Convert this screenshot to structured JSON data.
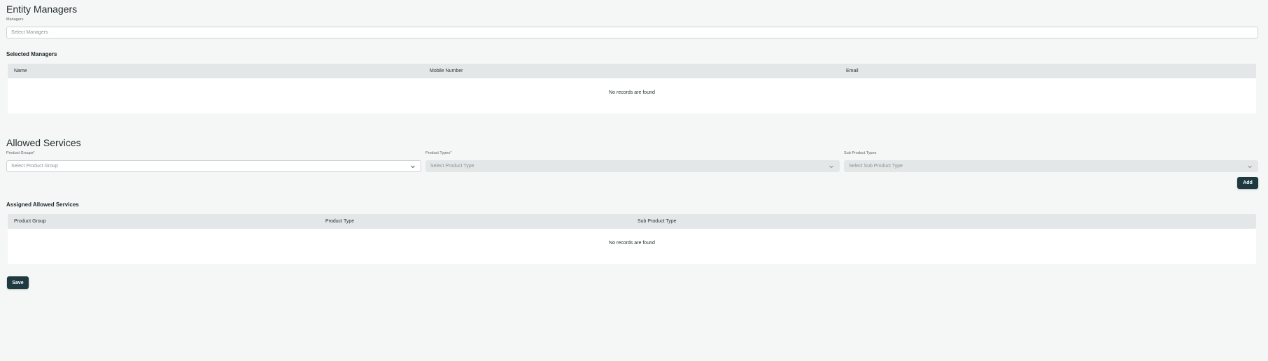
{
  "entity_managers": {
    "title": "Entity Managers",
    "managers_label": "Managers",
    "managers_placeholder": "Select Managers"
  },
  "selected_managers": {
    "title": "Selected Managers",
    "columns": [
      "Name",
      "Mobile Number",
      "Email"
    ],
    "empty_text": "No records are found"
  },
  "allowed_services": {
    "title": "Allowed Services",
    "product_groups_label": "Product Groups",
    "product_groups_placeholder": "Select Product Group",
    "product_types_label": "Product Types",
    "product_types_placeholder": "Select Product Type",
    "sub_product_types_label": "Sub Product Types",
    "sub_product_types_placeholder": "Select Sub Product Type",
    "required_marker": "*",
    "add_label": "Add"
  },
  "assigned_services": {
    "title": "Assigned Allowed Services",
    "columns": [
      "Product Group",
      "Product Type",
      "Sub Product Type"
    ],
    "empty_text": "No records are found"
  },
  "save_label": "Save",
  "colors": {
    "background": "#f5f7f6",
    "primary_button": "#1e3a40",
    "table_header": "#e3e7e7",
    "required": "#d9262b"
  }
}
